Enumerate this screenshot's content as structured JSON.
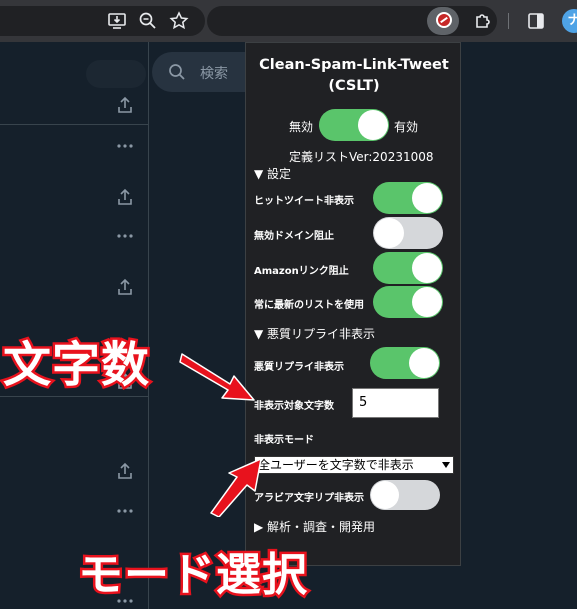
{
  "browser": {
    "toolbar_icons": [
      "install-app-icon",
      "zoom-icon",
      "bookmark-star-icon",
      "extension-cslt-icon",
      "puzzle-icon",
      "side-panel-icon",
      "profile-avatar"
    ],
    "profile_initial": "ナ"
  },
  "background_page": {
    "search_placeholder": "検索",
    "icons": [
      "share-icon",
      "more-icon"
    ]
  },
  "popup": {
    "title": "Clean-Spam-Link-Tweet (CSLT)",
    "master_toggle": {
      "off_label": "無効",
      "on_label": "有効",
      "state": "on"
    },
    "list_version": "定義リストVer:20231008",
    "settings_header": "▼ 設定",
    "settings": [
      {
        "label": "ヒットツイート非表示",
        "state": "on"
      },
      {
        "label": "無効ドメイン阻止",
        "state": "off"
      },
      {
        "label": "Amazonリンク阻止",
        "state": "on"
      },
      {
        "label": "常に最新のリストを使用",
        "state": "on"
      }
    ],
    "reply_header": "▼ 悪質リプライ非表示",
    "reply_hide_label": "悪質リプライ非表示",
    "reply_hide_state": "on",
    "char_count_label": "非表示対象文字数",
    "char_count_value": "5",
    "hide_mode_label": "非表示モード",
    "hide_mode_selected": "全ユーザーを文字数で非表示",
    "arabic_label": "アラビア文字リプ非表示",
    "arabic_state": "off",
    "analysis_header": "▶ 解析・調査・開発用"
  },
  "annotations": {
    "char_count": "文字数",
    "mode_select": "モード選択",
    "arrow_color": "#e8121d"
  },
  "colors": {
    "toggle_on": "#5ac56b",
    "toggle_off": "#d5d7da",
    "popup_bg": "#202124",
    "page_bg": "#15202b"
  }
}
